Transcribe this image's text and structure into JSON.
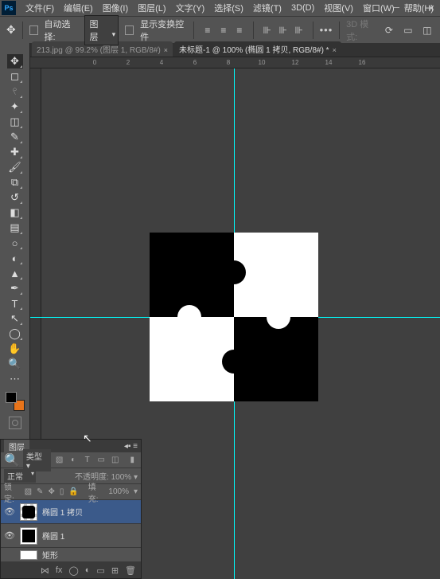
{
  "menu": {
    "items": [
      "文件(F)",
      "编辑(E)",
      "图像(I)",
      "图层(L)",
      "文字(Y)",
      "选择(S)",
      "滤镜(T)",
      "3D(D)",
      "视图(V)",
      "窗口(W)",
      "帮助(H)"
    ]
  },
  "options": {
    "auto_select": "自动选择:",
    "target": "图层",
    "show_transform": "显示变换控件",
    "mode": "3D 模式:"
  },
  "tabs": {
    "t0": {
      "label": "213.jpg @ 99.2% (图层 1, RGB/8#)"
    },
    "t1": {
      "label": "未标题-1 @ 100% (椭圆 1 拷贝, RGB/8#) *"
    }
  },
  "ruler": [
    "0",
    "2",
    "4",
    "6",
    "8",
    "10",
    "12",
    "14",
    "16"
  ],
  "layers_panel": {
    "title": "图层",
    "filter_kind": "类型",
    "blend": "正常",
    "opacity_label": "不透明度:",
    "opacity_val": "100%",
    "lock_label": "锁定:",
    "fill_label": "填充:",
    "fill_val": "100%",
    "rows": [
      {
        "name": "椭圆 1 拷贝"
      },
      {
        "name": "椭圆 1"
      },
      {
        "name": "矩形"
      }
    ]
  }
}
